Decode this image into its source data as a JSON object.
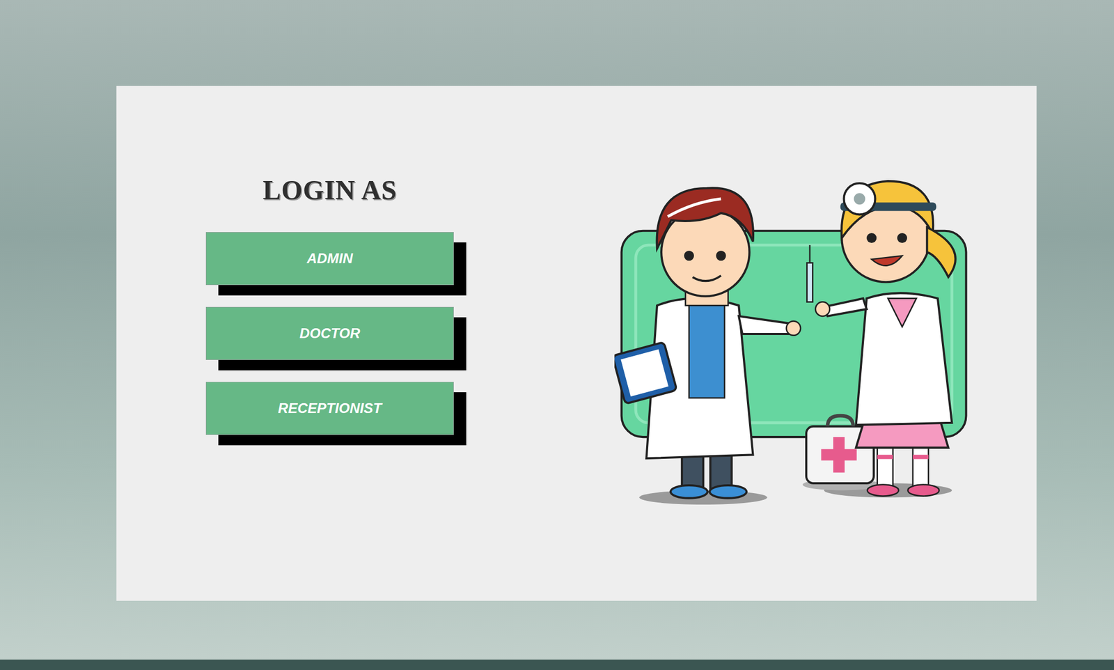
{
  "title": "LOGIN AS",
  "buttons": [
    {
      "label": "ADMIN"
    },
    {
      "label": "DOCTOR"
    },
    {
      "label": "RECEPTIONIST"
    }
  ]
}
